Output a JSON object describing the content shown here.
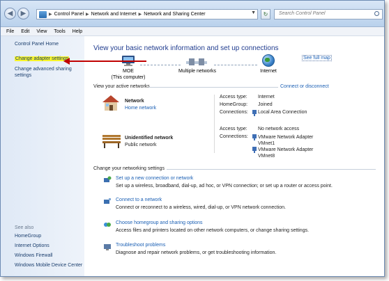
{
  "titlebar": {
    "breadcrumbs": [
      "Control Panel",
      "Network and Internet",
      "Network and Sharing Center"
    ],
    "search_placeholder": "Search Control Panel"
  },
  "menu": [
    "File",
    "Edit",
    "View",
    "Tools",
    "Help"
  ],
  "sidebar": {
    "home": "Control Panel Home",
    "links": [
      "Change adapter settings",
      "Change advanced sharing settings"
    ],
    "see_also_title": "See also",
    "see_also": [
      "HomeGroup",
      "Internet Options",
      "Windows Firewall",
      "Windows Mobile Device Center"
    ]
  },
  "main": {
    "heading": "View your basic network information and set up connections",
    "see_full_map": "See full map",
    "map": {
      "computer_name": "MOE",
      "computer_sub": "(This computer)",
      "middle": "Multiple networks",
      "internet": "Internet"
    },
    "active_title": "View your active networks",
    "connect_disconnect": "Connect or disconnect",
    "networks": [
      {
        "name": "Network",
        "type": "Home network",
        "access_label": "Access type:",
        "access_value": "Internet",
        "homegroup_label": "HomeGroup:",
        "homegroup_value": "Joined",
        "connections_label": "Connections:",
        "connections": [
          "Local Area Connection"
        ]
      },
      {
        "name": "Unidentified network",
        "type": "Public network",
        "access_label": "Access type:",
        "access_value": "No network access",
        "connections_label": "Connections:",
        "connections": [
          "VMware Network Adapter VMnet1",
          "VMware Network Adapter VMnet8"
        ]
      }
    ],
    "settings_title": "Change your networking settings",
    "tasks": [
      {
        "title": "Set up a new connection or network",
        "desc": "Set up a wireless, broadband, dial-up, ad hoc, or VPN connection; or set up a router or access point."
      },
      {
        "title": "Connect to a network",
        "desc": "Connect or reconnect to a wireless, wired, dial-up, or VPN network connection."
      },
      {
        "title": "Choose homegroup and sharing options",
        "desc": "Access files and printers located on other network computers, or change sharing settings."
      },
      {
        "title": "Troubleshoot problems",
        "desc": "Diagnose and repair network problems, or get troubleshooting information."
      }
    ]
  },
  "colors": {
    "link": "#1a5fb4",
    "heading": "#1f3b8e",
    "annotation": "#c00000",
    "highlight": "#f8f52a"
  }
}
